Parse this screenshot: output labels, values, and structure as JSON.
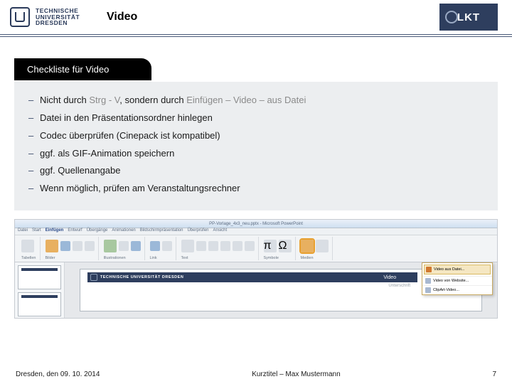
{
  "header": {
    "tud_text_l1": "TECHNISCHE",
    "tud_text_l2": "UNIVERSITÄT",
    "tud_text_l3": "DRESDEN",
    "title": "Video",
    "lkt": "LKT"
  },
  "checklist": {
    "title": "Checkliste für Video",
    "items": [
      {
        "pre": "Nicht durch ",
        "mut1": "Strg - V",
        "mid": ", sondern durch ",
        "mut2": "Einfügen – Video – aus Datei"
      },
      {
        "text": "Datei in den Präsentationsordner hinlegen"
      },
      {
        "text": "Codec überprüfen (Cinepack ist kompatibel)"
      },
      {
        "text": "ggf. als GIF-Animation speichern"
      },
      {
        "text": "ggf. Quellenangabe"
      },
      {
        "text": "Wenn möglich, prüfen am Veranstaltungsrechner"
      }
    ]
  },
  "ppt": {
    "titlebar": "PP-Vorlage_4x3_neu.pptx - Microsoft PowerPoint",
    "tabs": [
      "Datei",
      "Start",
      "Einfügen",
      "Entwurf",
      "Übergänge",
      "Animationen",
      "Bildschirmpräsentation",
      "Überprüfen",
      "Ansicht"
    ],
    "groups": [
      "Tabellen",
      "Bilder",
      "Illustrationen",
      "Link",
      "Text",
      "Symbole",
      "Medien"
    ],
    "slide_logo_l1": "TECHNISCHE",
    "slide_logo_l2": "UNIVERSITÄT",
    "slide_logo_l3": "DRESDEN",
    "slide_title": "Video",
    "slide_sub": "Unterschrift",
    "popup": {
      "highlight": "Video aus Datei...",
      "rows": [
        "Video von Website...",
        "ClipArt-Video..."
      ]
    }
  },
  "footer": {
    "left": "Dresden, den 09. 10. 2014",
    "center": "Kurztitel – Max Mustermann",
    "page": "7"
  }
}
